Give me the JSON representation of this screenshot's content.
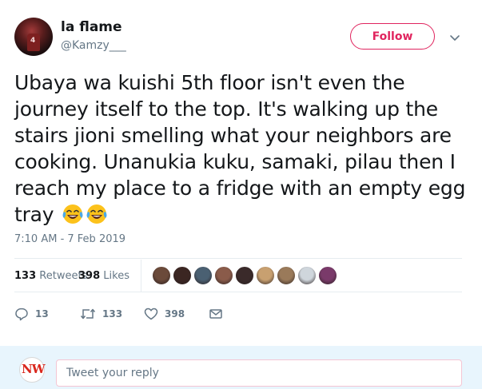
{
  "author": {
    "name": "la flame",
    "handle": "@Kamzy___",
    "avatar_jersey_number": "4"
  },
  "follow_button": {
    "label": "Follow",
    "color": "#e0245e"
  },
  "tweet": {
    "lines": [
      "Ubaya wa kuishi 5th floor isn't even the",
      "journey itself to the top. It's walking up the",
      "stairs jioni smelling what your neighbors are",
      "cooking. Unanukia kuku, samaki, pilau then I",
      "reach my place to a fridge with an empty egg",
      "tray"
    ],
    "emojis": [
      "face-with-tears-of-joy",
      "face-with-tears-of-joy"
    ],
    "timestamp": "7:10 AM - 7 Feb 2019"
  },
  "stats": {
    "retweets_count": "133",
    "retweets_label": "Retweets",
    "likes_count": "398",
    "likes_label": "Likes",
    "liker_avatar_colors": [
      "#6b4a3a",
      "#3b2622",
      "#4a6072",
      "#8a5b4a",
      "#3a2a2a",
      "#c8a070",
      "#9a7a5a",
      "#cfd6dc",
      "#7a3a6a"
    ]
  },
  "actions": {
    "reply_count": "13",
    "retweet_count": "133",
    "like_count": "398"
  },
  "reply_box": {
    "avatar_text": "NW",
    "placeholder": "Tweet your reply"
  },
  "colors": {
    "text": "#14171a",
    "secondary": "#657786",
    "accent": "#e0245e",
    "reply_bg": "#e8f5fd"
  }
}
